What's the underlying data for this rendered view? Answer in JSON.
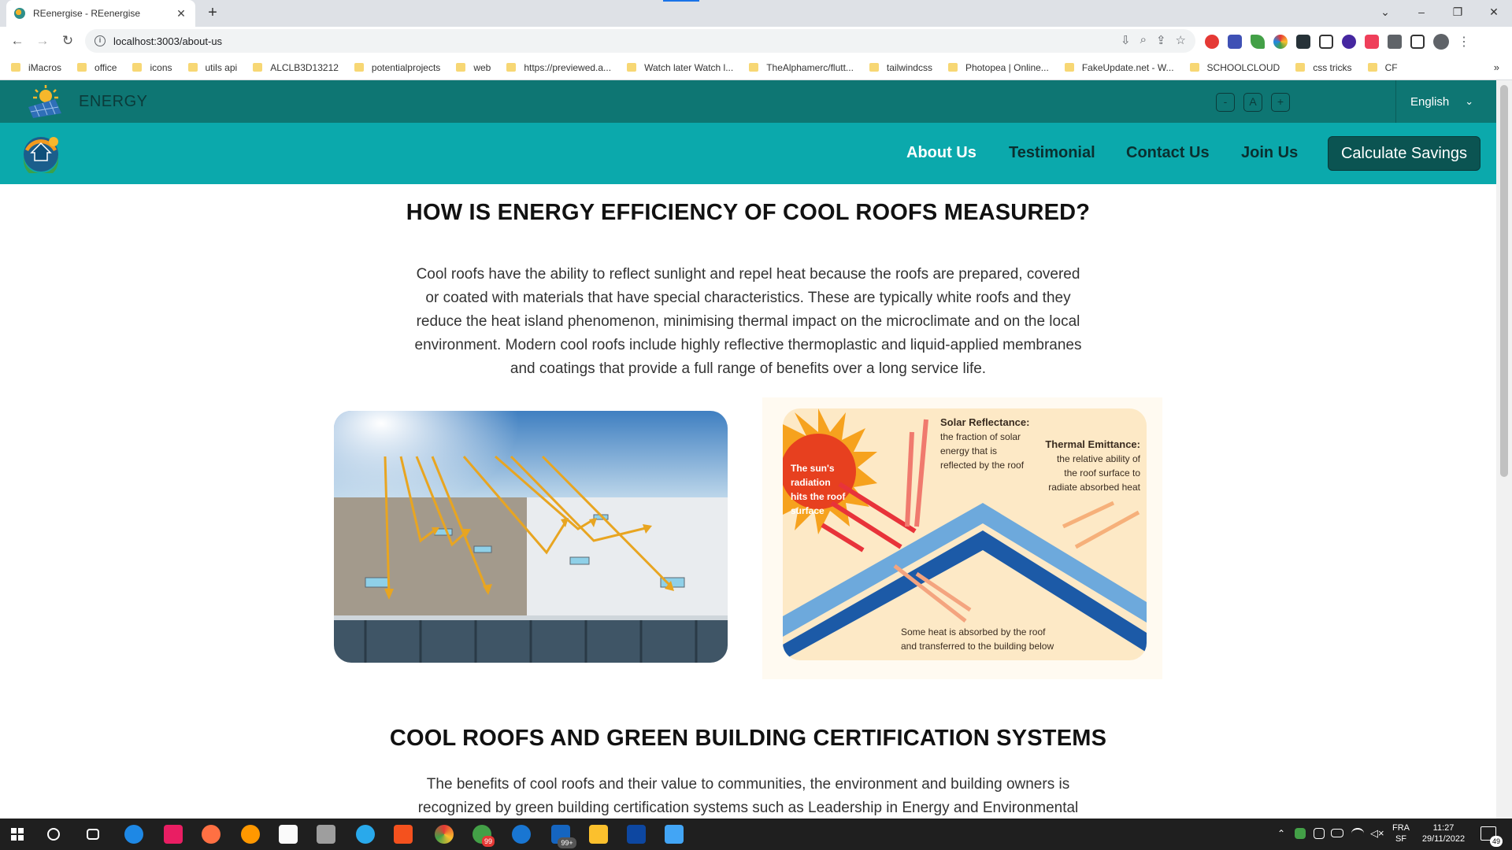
{
  "browser": {
    "tab_title": "REenergise - REenergise",
    "tab_close": "✕",
    "new_tab": "+",
    "url": "localhost:3003/about-us",
    "bookmarks": [
      "iMacros",
      "office",
      "icons",
      "utils api",
      "ALCLB3D13212",
      "potentialprojects",
      "web",
      "https://previewed.a...",
      "Watch later Watch l...",
      "TheAlphamerc/flutt...",
      "tailwindcss",
      "Photopea | Online...",
      "FakeUpdate.net - W...",
      "SCHOOLCLOUD",
      "css tricks",
      "CF"
    ],
    "bookmarks_more": "»"
  },
  "site": {
    "brand": "ENERGY",
    "font_controls": [
      "-",
      "A",
      "+"
    ],
    "language": "English",
    "nav": [
      "About Us",
      "Testimonial",
      "Contact Us",
      "Join Us"
    ],
    "cta": "Calculate Savings",
    "section1": {
      "title": "HOW IS ENERGY EFFICIENCY OF COOL ROOFS MEASURED?",
      "lines": [
        "Cool roofs have the ability to reflect sunlight and repel heat because the roofs are prepared, covered",
        "or coated with materials that have special characteristics. These are typically white roofs and they",
        "reduce the heat island phenomenon, minimising thermal impact on the microclimate and on the local",
        "environment. Modern cool roofs include highly reflective thermoplastic and liquid-applied membranes",
        "and coatings that provide a full range of benefits over a long service life."
      ]
    },
    "diagram": {
      "sun_label": [
        "The sun's",
        "radiation",
        "hits the roof",
        "surface"
      ],
      "reflectance_title": "Solar Reflectance:",
      "reflectance_text": [
        "the fraction of solar",
        "energy that is",
        "reflected by the roof"
      ],
      "emittance_title": "Thermal Emittance:",
      "emittance_text": [
        "the relative ability of",
        "the roof surface to",
        "radiate absorbed heat"
      ],
      "absorbed_text": [
        "Some heat is absorbed by the roof",
        "and transferred to the building below"
      ]
    },
    "section2": {
      "title": "COOL ROOFS AND GREEN BUILDING CERTIFICATION SYSTEMS",
      "lines": [
        "The benefits of cool roofs and their value to communities, the environment and building owners is",
        "recognized by green building certification systems such as Leadership in Energy and Environmental"
      ]
    }
  },
  "taskbar": {
    "lang": "FRA",
    "lang_sub": "SF",
    "time": "11:27",
    "date": "29/11/2022",
    "notif_count": "49",
    "badge_99": "99",
    "badge_99plus": "99+"
  }
}
